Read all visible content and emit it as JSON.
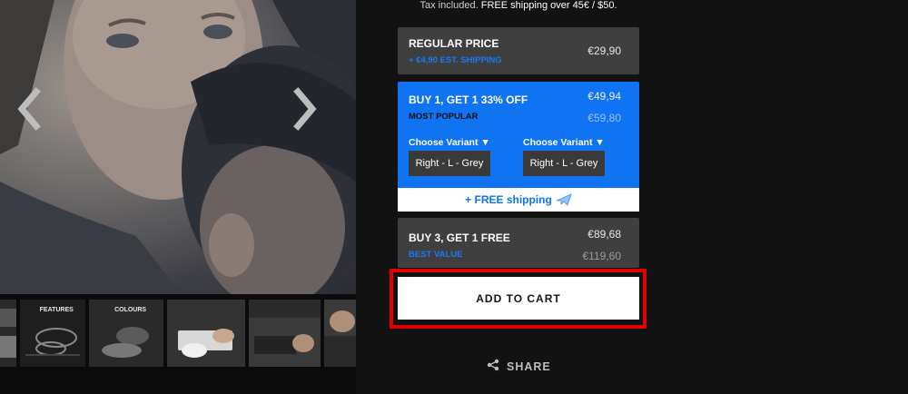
{
  "gallery": {
    "thumbnails": [
      {
        "label": ""
      },
      {
        "label": "FEATURES"
      },
      {
        "label": "COLOURS"
      },
      {
        "label": ""
      },
      {
        "label": ""
      },
      {
        "label": ""
      }
    ]
  },
  "tax_note": {
    "prefix": "Tax included.",
    "shipping": "FREE shipping over 45€ / $50."
  },
  "options": {
    "regular": {
      "title": "REGULAR PRICE",
      "sub": "+ €4,90 EST. SHIPPING",
      "price": "€29,90"
    },
    "bundle2": {
      "title": "BUY 1, GET 1 33% OFF",
      "sub": "MOST POPULAR",
      "price": "€49,94",
      "compare_price": "€59,80",
      "variant_label_1": "Choose Variant ▼",
      "variant_label_2": "Choose Variant ▼",
      "variant_value_1": "Right - L - Grey",
      "variant_value_2": "Right - L - Grey",
      "shipping_badge": "+ FREE shipping"
    },
    "bundle3": {
      "title": "BUY 3, GET 1 FREE",
      "sub": "BEST VALUE",
      "price": "€89,68",
      "compare_price": "€119,60"
    }
  },
  "cart": {
    "label": "ADD TO CART"
  },
  "share": {
    "label": "SHARE"
  },
  "colors": {
    "accent_blue": "#0f73f2",
    "highlight_red": "#e10000",
    "panel_grey": "#3f3f3f",
    "background": "#121212"
  }
}
